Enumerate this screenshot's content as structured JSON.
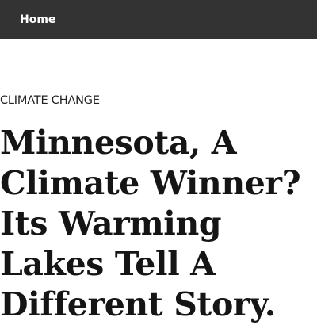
{
  "navbar": {
    "home_label": "Home",
    "background_color": "#333333",
    "text_color": "#ffffff"
  },
  "article": {
    "category": "Climate Change",
    "headline_lines": [
      "Minnesota, A",
      "Climate Winner?",
      "Its Warming",
      "Lakes Tell A",
      "Different Story."
    ]
  }
}
